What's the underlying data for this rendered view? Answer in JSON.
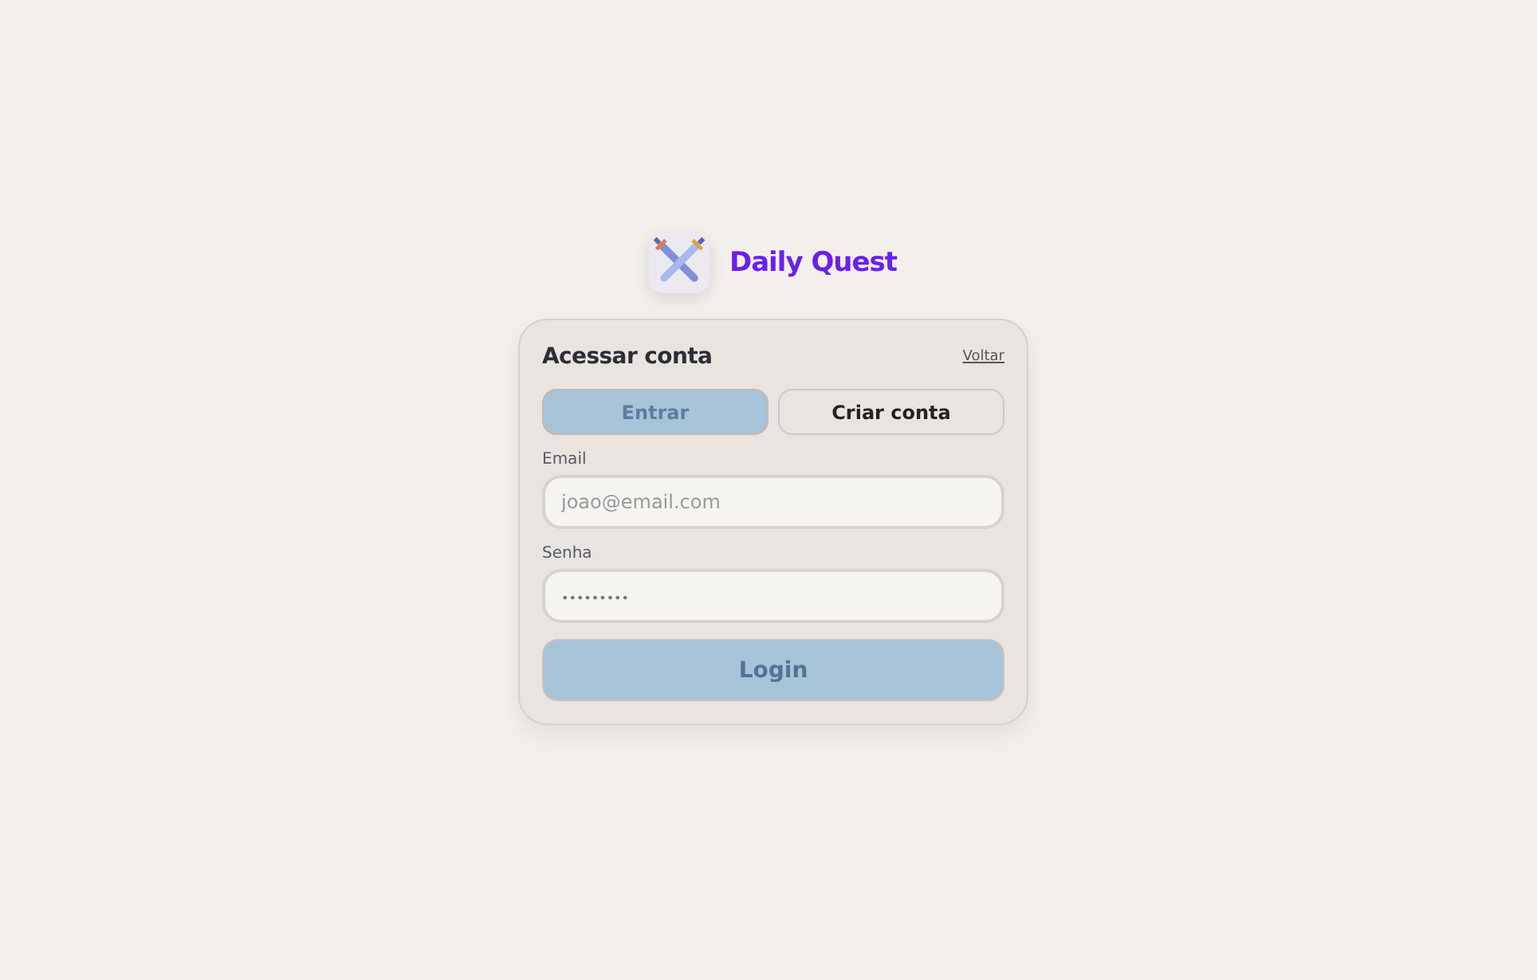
{
  "brand": {
    "name": "Daily Quest"
  },
  "card": {
    "title": "Acessar conta",
    "back_link": "Voltar"
  },
  "tabs": [
    {
      "label": "Entrar",
      "selected": true
    },
    {
      "label": "Criar conta",
      "selected": false
    }
  ],
  "fields": [
    {
      "label": "Email",
      "placeholder": "joao@email.com",
      "kind": "plain"
    },
    {
      "label": "Senha",
      "placeholder": "•••••••••",
      "kind": "secret"
    }
  ],
  "submit": "Login"
}
